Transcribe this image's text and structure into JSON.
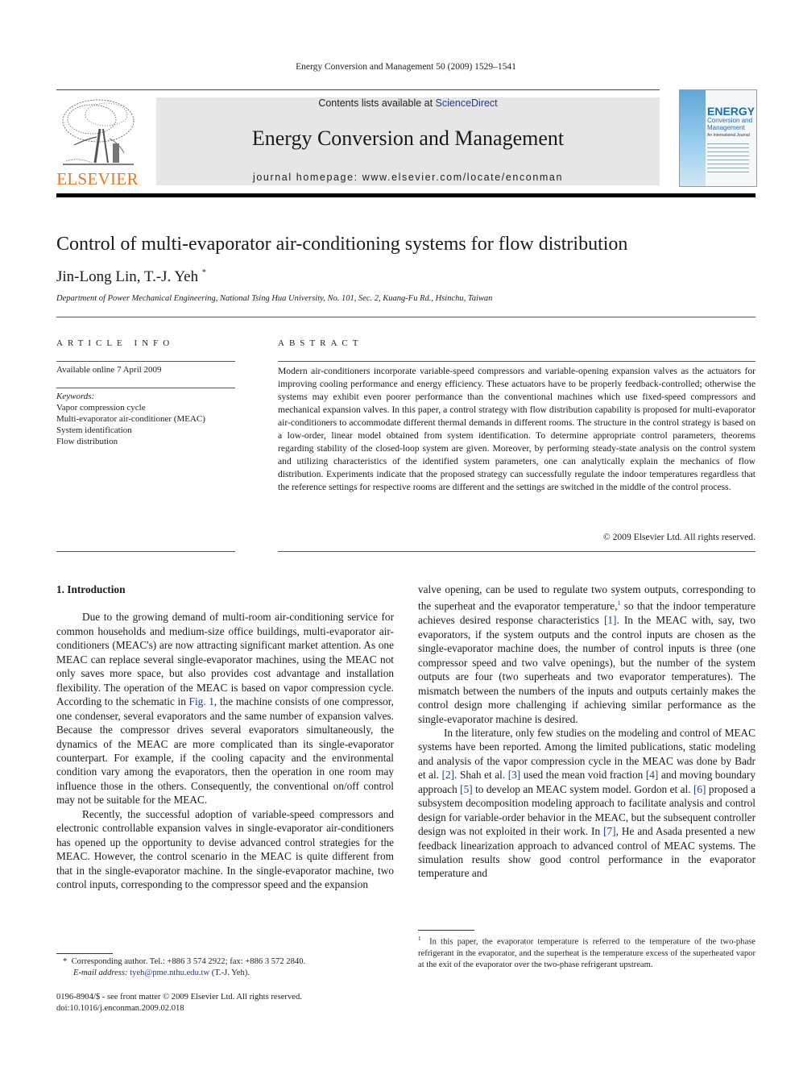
{
  "running_head": "Energy Conversion and Management 50 (2009) 1529–1541",
  "publisher": {
    "logo_icon": "elsevier-tree-icon",
    "wordmark": "ELSEVIER",
    "wordmark_color": "#e87722"
  },
  "banner": {
    "contents_prefix": "Contents lists available at ",
    "sciencedirect_link": "ScienceDirect",
    "journal_title": "Energy Conversion and Management",
    "homepage": "journal homepage: www.elsevier.com/locate/enconman",
    "link_color": "#1e3c96"
  },
  "cover": {
    "title_line1": "ENERGY",
    "title_line2": "Conversion and Management",
    "tagline": "An International Journal"
  },
  "article": {
    "title": "Control of multi-evaporator air-conditioning systems for flow distribution",
    "authors": "Jin-Long Lin, T.-J. Yeh",
    "author_marker": "*",
    "affiliation": "Department of Power Mechanical Engineering, National Tsing Hua University, No. 101, Sec. 2, Kuang-Fu Rd., Hsinchu, Taiwan"
  },
  "article_info": {
    "heading": "ARTICLE INFO",
    "available_online": "Available online 7 April 2009",
    "keywords_label": "Keywords:",
    "keywords": [
      "Vapor compression cycle",
      "Multi-evaporator air-conditioner (MEAC)",
      "System identification",
      "Flow distribution"
    ]
  },
  "abstract": {
    "heading": "ABSTRACT",
    "text": "Modern air-conditioners incorporate variable-speed compressors and variable-opening expansion valves as the actuators for improving cooling performance and energy efficiency. These actuators have to be properly feedback-controlled; otherwise the systems may exhibit even poorer performance than the conventional machines which use fixed-speed compressors and mechanical expansion valves. In this paper, a control strategy with flow distribution capability is proposed for multi-evaporator air-conditioners to accommodate different thermal demands in different rooms. The structure in the control strategy is based on a low-order, linear model obtained from system identification. To determine appropriate control parameters, theorems regarding stability of the closed-loop system are given. Moreover, by performing steady-state analysis on the control system and utilizing characteristics of the identified system parameters, one can analytically explain the mechanics of flow distribution. Experiments indicate that the proposed strategy can successfully regulate the indoor temperatures regardless that the reference settings for respective rooms are different and the settings are switched in the middle of the control process.",
    "copyright": "© 2009 Elsevier Ltd. All rights reserved."
  },
  "body": {
    "section_heading": "1. Introduction",
    "left": {
      "p1_a": "Due to the growing demand of multi-room air-conditioning service for common households and medium-size office buildings, multi-evaporator air-conditioners (MEAC's) are now attracting significant market attention. As one MEAC can replace several single-evaporator machines, using the MEAC not only saves more space, but also provides cost advantage and installation flexibility. The operation of the MEAC is based on vapor compression cycle. According to the schematic in ",
      "p1_link": "Fig. 1",
      "p1_b": ", the machine consists of one compressor, one condenser, several evaporators and the same number of expansion valves. Because the compressor drives several evaporators simultaneously, the dynamics of the MEAC are more complicated than its single-evaporator counterpart. For example, if the cooling capacity and the environmental condition vary among the evaporators, then the operation in one room may influence those in the others. Consequently, the conventional on/off control may not be suitable for the MEAC.",
      "p2": "Recently, the successful adoption of variable-speed compressors and electronic controllable expansion valves in single-evaporator air-conditioners has opened up the opportunity to devise advanced control strategies for the MEAC. However, the control scenario in the MEAC is quite different from that in the single-evaporator machine. In the single-evaporator machine, two control inputs, corresponding to the compressor speed and the expansion"
    },
    "right": {
      "p1_a": "valve opening, can be used to regulate two system outputs, corresponding to the superheat and the evaporator temperature,",
      "p1_fnref": "1",
      "p1_b": " so that the indoor temperature achieves desired response characteristics ",
      "ref1": "[1]",
      "p1_c": ". In the MEAC with, say, two evaporators, if the system outputs and the control inputs are chosen as the single-evaporator machine does, the number of control inputs is three (one compressor speed and two valve openings), but the number of the system outputs are four (two superheats and two evaporator temperatures). The mismatch between the numbers of the inputs and outputs certainly makes the control design more challenging if achieving similar performance as the single-evaporator machine is desired.",
      "p2_a": "In the literature, only few studies on the modeling and control of MEAC systems have been reported. Among the limited publications, static modeling and analysis of the vapor compression cycle in the MEAC was done by Badr et al. ",
      "ref2": "[2]",
      "p2_b": ". Shah et al. ",
      "ref3": "[3]",
      "p2_c": " used the mean void fraction ",
      "ref4": "[4]",
      "p2_d": " and moving boundary approach ",
      "ref5": "[5]",
      "p2_e": " to develop an MEAC system model. Gordon et al. ",
      "ref6": "[6]",
      "p2_f": " proposed a subsystem decomposition modeling approach to facilitate analysis and control design for variable-order behavior in the MEAC, but the subsequent controller design was not exploited in their work. In ",
      "ref7": "[7]",
      "p2_g": ", He and Asada presented a new feedback linearization approach to advanced control of MEAC systems. The simulation results show good control performance in the evaporator temperature and"
    }
  },
  "footnotes": {
    "corresponding_marker": "*",
    "corresponding": "Corresponding author. Tel.: +886 3 574 2922; fax: +886 3 572 2840.",
    "email_label": "E-mail address: ",
    "email": "tyeh@pme.nthu.edu.tw",
    "email_suffix": " (T.-J. Yeh).",
    "issn": "0196-8904/$ - see front matter © 2009 Elsevier Ltd. All rights reserved.",
    "doi": "doi:10.1016/j.enconman.2009.02.018",
    "fn1_marker": "1",
    "fn1": "In this paper, the evaporator temperature is referred to the temperature of the two-phase refrigerant in the evaporator, and the superheat is the temperature excess of the superheated vapor at the exit of the evaporator over the two-phase refrigerant upstream."
  }
}
